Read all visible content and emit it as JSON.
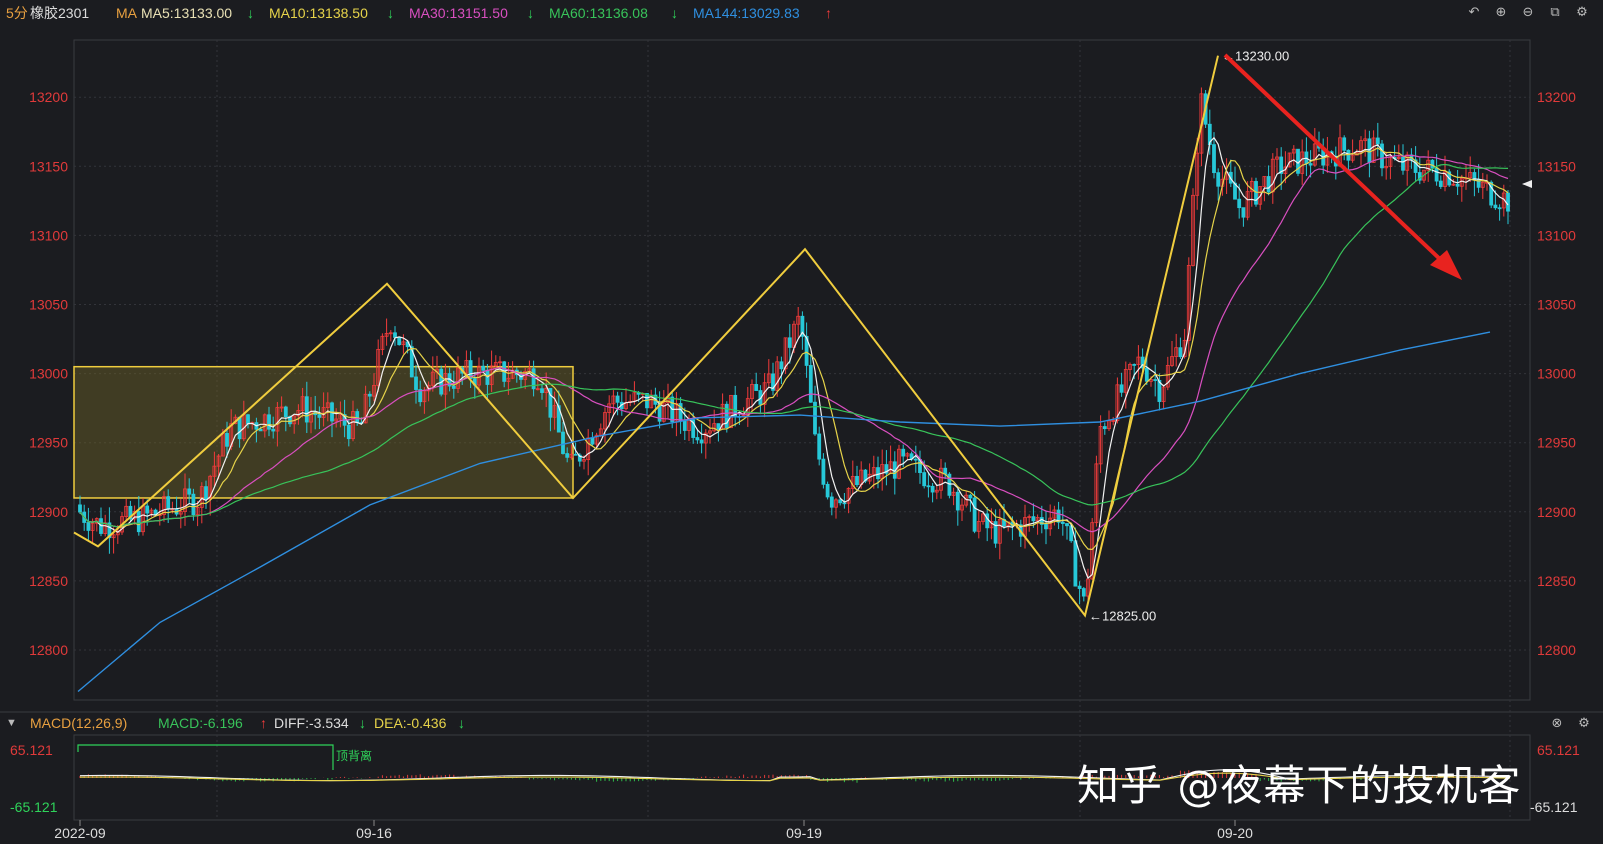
{
  "header": {
    "period": "5分",
    "symbol": "橡胶2301",
    "ma_label": "MA",
    "ma": [
      {
        "text": "MA5:13133.00",
        "arrow": "↓",
        "color": "#e8e0b4",
        "arrow_color": "#2fd35a"
      },
      {
        "text": "MA10:13138.50",
        "arrow": "↓",
        "color": "#e6d34a",
        "arrow_color": "#2fd35a"
      },
      {
        "text": "MA30:13151.50",
        "arrow": "↓",
        "color": "#d94fc0",
        "arrow_color": "#2fd35a"
      },
      {
        "text": "MA60:13136.08",
        "arrow": "↓",
        "color": "#38c35a",
        "arrow_color": "#2fd35a"
      },
      {
        "text": "MA144:13029.83",
        "arrow": "↑",
        "color": "#2f8fe0",
        "arrow_color": "#f23b3b"
      }
    ],
    "icons": [
      "undo-icon",
      "zoom-in-icon",
      "zoom-out-icon",
      "window-icon",
      "settings-icon"
    ]
  },
  "macd_header": {
    "title": "MACD(12,26,9)",
    "macd": "MACD:-6.196",
    "macd_arrow": "↑",
    "diff": "DIFF:-3.534",
    "diff_arrow": "↓",
    "dea": "DEA:-0.436",
    "dea_arrow": "↓",
    "icons": [
      "close-icon",
      "settings-icon"
    ]
  },
  "macd_axis": {
    "top": "65.121",
    "bottom": "-65.121"
  },
  "divergence_label": "顶背离",
  "x_labels": [
    "2022-09",
    "09-16",
    "09-19",
    "09-20"
  ],
  "watermark": "知乎 @夜幕下的投机客",
  "colors": {
    "up": "#f23b3b",
    "down": "#27c8d8",
    "zigzag": "#f0cd3e",
    "arrow": "#e8231f",
    "axis_text": "#e03a3a"
  },
  "chart_data": {
    "type": "candlestick",
    "title": "",
    "ylim": [
      12760,
      13240
    ],
    "y_ticks": [
      12800,
      12850,
      12900,
      12950,
      13000,
      13050,
      13100,
      13150,
      13200
    ],
    "grid": true,
    "annotations": [
      {
        "label": "13230.00",
        "value": 13230
      },
      {
        "label": "12825.00",
        "value": 12825
      }
    ],
    "price_box": {
      "from": "2022-09",
      "to": "09-16",
      "low": 12910,
      "high": 13005
    },
    "zigzag": [
      12885,
      12875,
      13065,
      12910,
      13090,
      12825,
      13230
    ],
    "series": [
      {
        "name": "MA144",
        "last": 13029.83
      },
      {
        "name": "MA60",
        "last": 13136.08
      },
      {
        "name": "MA30",
        "last": 13151.5
      },
      {
        "name": "MA10",
        "last": 13138.5
      },
      {
        "name": "MA5",
        "last": 13133.0
      }
    ],
    "macd": {
      "ylim": [
        -65.121,
        65.121
      ],
      "macd": -6.196,
      "diff": -3.534,
      "dea": -0.436
    }
  }
}
